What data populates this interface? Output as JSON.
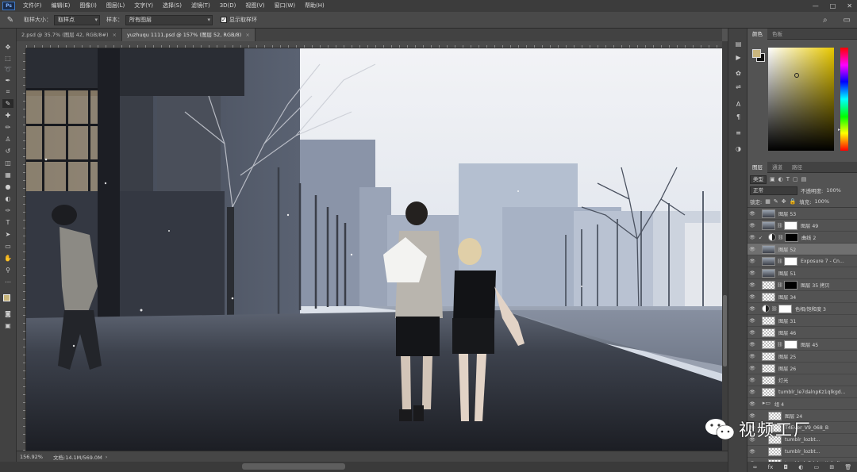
{
  "app": {
    "logo": "Ps"
  },
  "menu": [
    "文件(F)",
    "编辑(E)",
    "图像(I)",
    "图层(L)",
    "文字(Y)",
    "选择(S)",
    "滤镜(T)",
    "3D(D)",
    "视图(V)",
    "窗口(W)",
    "帮助(H)"
  ],
  "window_buttons": [
    "—",
    "□",
    "✕"
  ],
  "options": {
    "sample_size_label": "取样大小：",
    "sample_size_value": "取样点",
    "sample_label": "样本：",
    "sample_value": "所有图层",
    "show_ring_label": "显示取样环",
    "show_ring_checked": true
  },
  "tabs": [
    {
      "label": "2.psd @ 35.7% (图层 42, RGB/8#)",
      "active": false
    },
    {
      "label": "yuzhuqu 1111.psd @ 157% (图层 52, RGB/8)",
      "active": true
    }
  ],
  "status": {
    "zoom": "156.92%",
    "doc": "文档:14.1M/569.0M"
  },
  "panels": {
    "color_tabs": [
      "颜色",
      "色板"
    ],
    "layer_tabs": [
      "图层",
      "通道",
      "路径"
    ],
    "kind": "类型",
    "blend_mode": "正常",
    "opacity_label": "不透明度:",
    "opacity_value": "100%",
    "lock_label": "锁定:",
    "fill_label": "填充:",
    "fill_value": "100%"
  },
  "layers": [
    {
      "name": "图层 53",
      "thumb": "photo"
    },
    {
      "name": "图层 49",
      "thumb": "photo",
      "mask": "white"
    },
    {
      "name": "曲线 2",
      "thumb": "adj",
      "mask": "blk",
      "clip": true
    },
    {
      "name": "图层 52",
      "thumb": "photo",
      "selected": true
    },
    {
      "name": "Exposure 7 - Cn...",
      "thumb": "photo",
      "mask": "white"
    },
    {
      "name": "图层 51",
      "thumb": "photo"
    },
    {
      "name": "图层 35 拷贝",
      "thumb": "trans",
      "mask": "blk"
    },
    {
      "name": "图层 34",
      "thumb": "trans"
    },
    {
      "name": "色相/饱和度 3",
      "thumb": "adj",
      "mask": "white"
    },
    {
      "name": "图层 31",
      "thumb": "trans"
    },
    {
      "name": "图层 46",
      "thumb": "trans"
    },
    {
      "name": "图层 45",
      "thumb": "trans",
      "mask": "white"
    },
    {
      "name": "图层 25",
      "thumb": "trans"
    },
    {
      "name": "图层 26",
      "thumb": "trans"
    },
    {
      "name": "灯光",
      "thumb": "trans"
    },
    {
      "name": "tumblr_le7dalnpKz1qlkgd...",
      "thumb": "trans"
    },
    {
      "name": "组 4",
      "thumb": "folder"
    },
    {
      "name": "图层 24",
      "thumb": "trans",
      "indent": true
    },
    {
      "name": "T4Ever_V9_068_B",
      "thumb": "trans",
      "indent": true
    },
    {
      "name": "tumblr_lozbt...",
      "thumb": "trans",
      "indent": true
    },
    {
      "name": "tumblr_lozbt...",
      "thumb": "trans",
      "indent": true
    },
    {
      "name": "tumblr_le7dalnpKz1qlk...",
      "thumb": "trans",
      "indent": true
    }
  ],
  "watermark": "视频工厂",
  "icons": {
    "eyedropper": "eyedropper-icon",
    "eye": "eye-icon"
  }
}
